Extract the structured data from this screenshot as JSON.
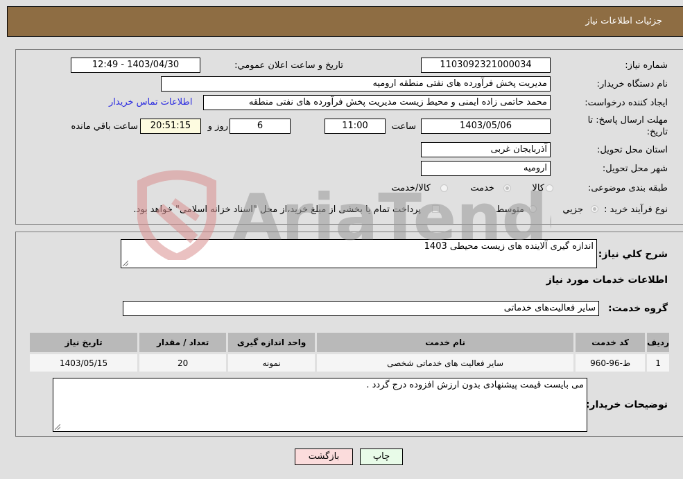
{
  "header": {
    "title": "جزئیات اطلاعات نیاز"
  },
  "details": {
    "need_number_label": "شماره نیاز:",
    "need_number": "1103092321000034",
    "announce_label": "تاریخ و ساعت اعلان عمومي:",
    "announce_value": "1403/04/30 - 12:49",
    "buyer_org_label": "نام دستگاه خریدار:",
    "buyer_org": "مدیریت پخش فرآورده های نفتی منطقه ارومیه",
    "creator_label": "ایجاد کننده درخواست:",
    "creator": "محمد حاتمی زاده ایمنی و محیط زیست مدیریت پخش فرآورده های نفتی منطقه",
    "contact_link": "اطلاعات تماس خریدار",
    "deadline_label": "مهلت ارسال پاسخ: تا تاریخ:",
    "deadline_date": "1403/05/06",
    "time_label": "ساعت",
    "deadline_time": "11:00",
    "days_value": "6",
    "days_label": "روز و",
    "remaining_time": "20:51:15",
    "remaining_label": "ساعت باقي مانده",
    "province_label": "استان محل تحویل:",
    "province": "آذربایجان غربی",
    "city_label": "شهر محل تحویل:",
    "city": "ارومیه",
    "category_label": "طبقه بندی موضوعی:",
    "category_options": [
      {
        "label": "کالا",
        "checked": false
      },
      {
        "label": "خدمت",
        "checked": true
      },
      {
        "label": "کالا/خدمت",
        "checked": false
      }
    ],
    "process_label": "نوع فرآیند خرید :",
    "process_options": [
      {
        "label": "جزيي",
        "checked": true
      },
      {
        "label": "متوسط",
        "checked": false
      }
    ],
    "payment_note": "پرداخت تمام یا بخشی از مبلغ خرید،از محل \"اسناد خزانه اسلامی\" خواهد بود."
  },
  "summary": {
    "description_label": "شرح کلي نياز:",
    "description": "اندازه گیری آلاینده های زیست محیطی 1403",
    "services_heading": "اطلاعات خدمات مورد نیاز",
    "service_group_label": "گروه خدمت:",
    "service_group": "سایر فعالیت‌های خدماتی"
  },
  "table": {
    "headers": [
      "ردیف",
      "کد خدمت",
      "نام خدمت",
      "واحد اندازه گیری",
      "تعداد / مقدار",
      "تاریخ نیاز"
    ],
    "rows": [
      [
        "1",
        "ط-96-960",
        "سایر فعالیت های خدماتی شخصی",
        "نمونه",
        "20",
        "1403/05/15"
      ]
    ]
  },
  "buyer_notes": {
    "label": "توضیحات خریدار:",
    "text": "می بایست قیمت پیشنهادی بدون ارزش افزوده درج گردد ."
  },
  "buttons": {
    "print": "چاپ",
    "back": "بازگشت"
  },
  "watermark": {
    "text": "AriaTender.neT"
  }
}
